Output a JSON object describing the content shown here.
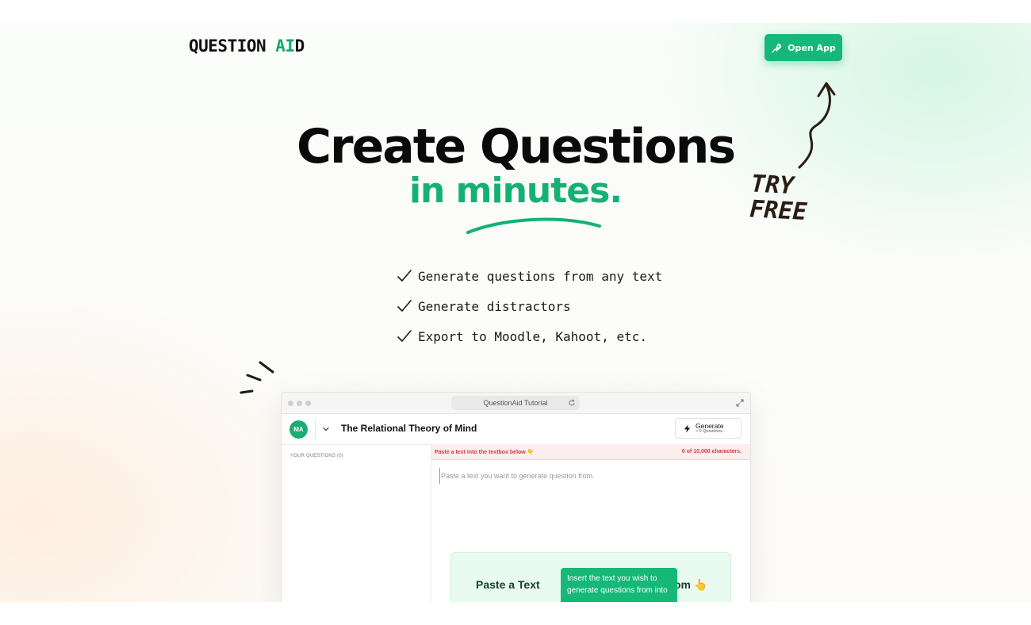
{
  "header": {
    "logo_main": "QUESTION ",
    "logo_accent": "AI",
    "logo_tail": "D",
    "open_app_label": "Open App"
  },
  "hero": {
    "title": "Create Questions",
    "subtitle": "in minutes.",
    "try_free_line1": "TRY",
    "try_free_line2": "FREE"
  },
  "features": [
    "Generate questions from any text",
    "Generate distractors",
    "Export to Moodle, Kahoot, etc."
  ],
  "demo": {
    "url_title": "QuestionAid Tutorial",
    "avatar_initials": "MA",
    "doc_title": "The Relational Theory of Mind",
    "generate_label": "Generate",
    "generate_sub": "≈ 0 Questions",
    "sidebar_label": "YOUR QUESTIONS (0)",
    "notice_left": "Paste a text into the textbox below 👇",
    "notice_right": "0 of 10,000 characters.",
    "textarea_placeholder": "Paste a text you want to generate question from.",
    "card_heading_left": "Paste a Text",
    "card_heading_right": "om 👆",
    "tooltip_text": "Insert the text you wish to generate questions from into"
  },
  "colors": {
    "brand_green": "#16b877",
    "title_black": "#0a0a0a",
    "notice_red": "#d13b3b"
  }
}
